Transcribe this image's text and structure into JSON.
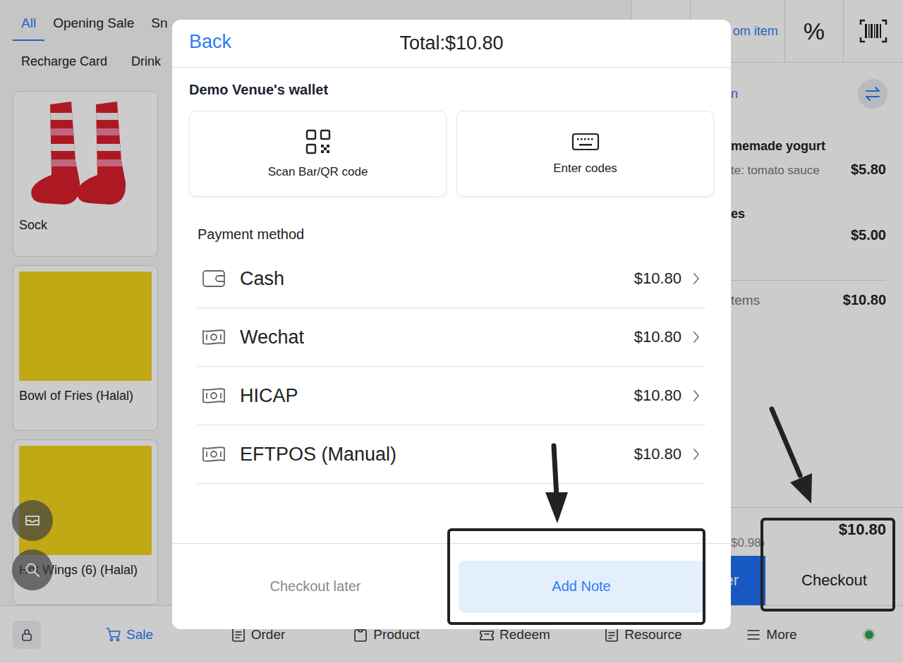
{
  "app": {
    "category_tabs": [
      {
        "label": "All",
        "selected": true
      },
      {
        "label": "Opening Sale",
        "selected": false
      },
      {
        "label": "Sn",
        "selected": false
      }
    ],
    "category_tabs_row2": [
      {
        "label": "Recharge Card"
      },
      {
        "label": "Drink"
      }
    ],
    "products": [
      {
        "name": "Sock",
        "kind": "socks"
      },
      {
        "name": "Bowl of Fries (Halal)",
        "kind": "photo"
      },
      {
        "name": "Hot Wings (6) (Halal)",
        "kind": "photo"
      }
    ],
    "toolbar": {
      "custom_item": "om item",
      "discount": "%"
    },
    "customer_link": "n",
    "cart": {
      "items": [
        {
          "name": "memade yogurt",
          "price": "$5.80",
          "note": "te: tomato sauce"
        },
        {
          "name": "es",
          "price": "$5.00",
          "note": ""
        }
      ],
      "summary_label": "tems",
      "summary_value": "$10.80",
      "tax": "$0.98)",
      "total": "$10.80",
      "order_button": "er",
      "checkout_button": "Checkout",
      "checkout_highlighted": true
    },
    "nav": [
      {
        "label": "Sale",
        "kind": "sale",
        "selected": true
      },
      {
        "label": "Order",
        "kind": "order",
        "selected": false
      },
      {
        "label": "Product",
        "kind": "product",
        "selected": false
      },
      {
        "label": "Redeem",
        "kind": "redeem",
        "selected": false
      },
      {
        "label": "Resource",
        "kind": "resource",
        "selected": false
      },
      {
        "label": "More",
        "kind": "more",
        "selected": false
      }
    ],
    "online": true
  },
  "dialog": {
    "back": "Back",
    "title": "Total:$10.80",
    "wallet_title": "Demo Venue's wallet",
    "wallet_actions": [
      {
        "label": "Scan Bar/QR code",
        "kind": "scan"
      },
      {
        "label": "Enter codes",
        "kind": "keyboard"
      }
    ],
    "payment_title": "Payment method",
    "payment_methods": [
      {
        "name": "Cash",
        "amount": "$10.80",
        "kind": "cash"
      },
      {
        "name": "Wechat",
        "amount": "$10.80",
        "kind": "note"
      },
      {
        "name": "HICAP",
        "amount": "$10.80",
        "kind": "note"
      },
      {
        "name": "EFTPOS (Manual)",
        "amount": "$10.80",
        "kind": "note"
      }
    ],
    "footer": {
      "secondary": "Checkout later",
      "primary": "Add Note",
      "primary_highlighted": true
    }
  }
}
